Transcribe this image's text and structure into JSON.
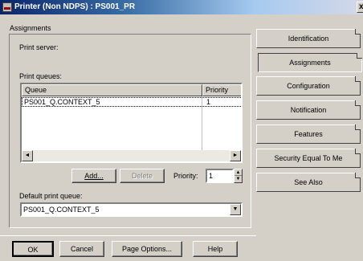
{
  "window": {
    "title": "Printer (Non NDPS) : PS001_PR",
    "close_glyph": "x"
  },
  "section": {
    "title": "Assignments"
  },
  "form": {
    "print_server_label": "Print server:",
    "print_queues_label": "Print queues:",
    "list": {
      "columns": [
        "Queue",
        "Priority"
      ],
      "rows": [
        {
          "queue": "PS001_Q.CONTEXT_5",
          "priority": "1"
        }
      ]
    },
    "add_button": "Add...",
    "delete_button": "Delete",
    "priority_label": "Priority:",
    "priority_value": "1",
    "default_queue_label": "Default print queue:",
    "default_queue_value": "PS001_Q.CONTEXT_5"
  },
  "tabs": [
    {
      "label": "Identification",
      "active": false
    },
    {
      "label": "Assignments",
      "active": true
    },
    {
      "label": "Configuration",
      "active": false
    },
    {
      "label": "Notification",
      "active": false
    },
    {
      "label": "Features",
      "active": false
    },
    {
      "label": "Security Equal To Me",
      "active": false
    },
    {
      "label": "See Also",
      "active": false
    }
  ],
  "footer": {
    "ok": "OK",
    "cancel": "Cancel",
    "page_options": "Page Options...",
    "help": "Help"
  },
  "icons": {
    "printer": "printer-icon",
    "scroll_left": "◄",
    "scroll_right": "►",
    "dropdown": "▼",
    "spin_up": "▲",
    "spin_down": "▼"
  }
}
